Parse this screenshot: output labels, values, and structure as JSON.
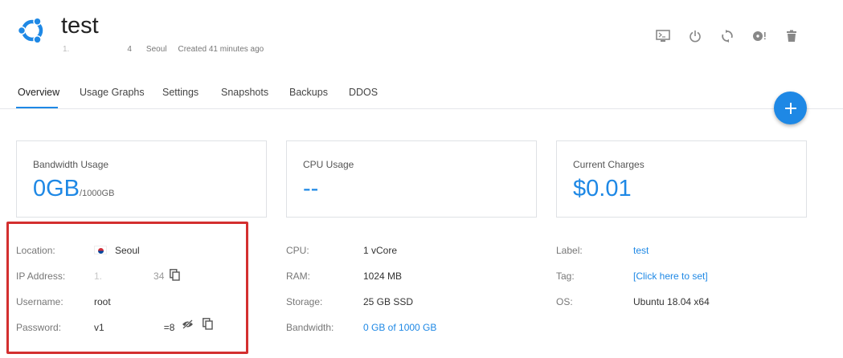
{
  "server": {
    "name": "test",
    "ip_partial_start": "1.",
    "ip_partial_end": "4",
    "location": "Seoul",
    "created": "Created 41 minutes ago"
  },
  "header_actions": [
    {
      "icon": "console-icon"
    },
    {
      "icon": "power-icon"
    },
    {
      "icon": "restart-icon"
    },
    {
      "icon": "iso-disc-icon"
    },
    {
      "icon": "trash-icon"
    }
  ],
  "tabs": [
    {
      "label": "Overview"
    },
    {
      "label": "Usage Graphs"
    },
    {
      "label": "Settings"
    },
    {
      "label": "Snapshots"
    },
    {
      "label": "Backups"
    },
    {
      "label": "DDOS"
    }
  ],
  "cards": {
    "bandwidth": {
      "label": "Bandwidth Usage",
      "value": "0GB",
      "unit": "/1000GB"
    },
    "cpu": {
      "label": "CPU Usage",
      "value": "--"
    },
    "charges": {
      "label": "Current Charges",
      "value": "$0.01"
    }
  },
  "left_info": {
    "location_label": "Location:",
    "location_value": "Seoul",
    "ip_label": "IP Address:",
    "ip_start": "1.",
    "ip_end": "34",
    "username_label": "Username:",
    "username_value": "root",
    "password_label": "Password:",
    "password_start": "v1",
    "password_end": "=8"
  },
  "mid_info": {
    "cpu_label": "CPU:",
    "cpu_value": "1 vCore",
    "ram_label": "RAM:",
    "ram_value": "1024 MB",
    "storage_label": "Storage:",
    "storage_value": "25 GB SSD",
    "bandwidth_label": "Bandwidth:",
    "bandwidth_value": "0 GB of 1000 GB"
  },
  "right_info": {
    "label_label": "Label:",
    "label_value": "test",
    "tag_label": "Tag:",
    "tag_value": "[Click here to set]",
    "os_label": "OS:",
    "os_value": "Ubuntu 18.04 x64"
  },
  "colors": {
    "accent": "#1e88e5",
    "highlight": "#d32f2f"
  }
}
